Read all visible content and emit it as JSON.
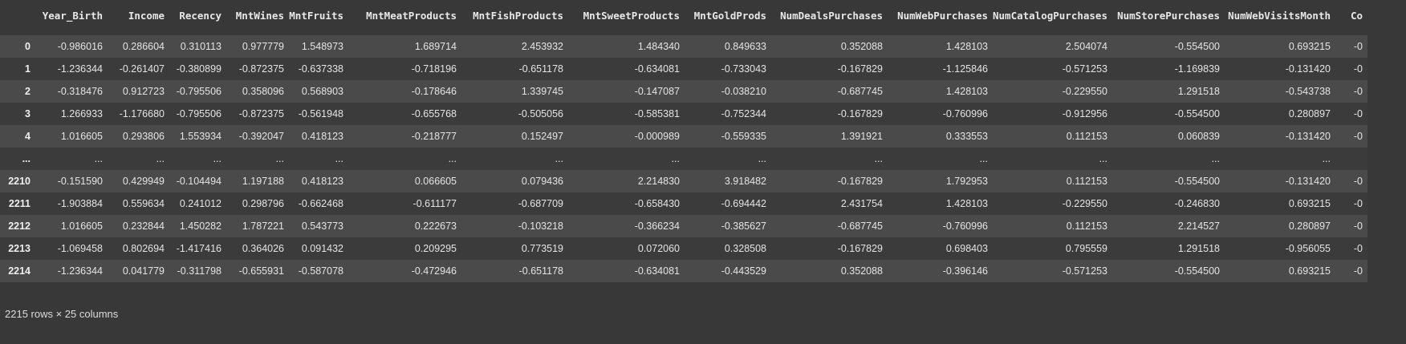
{
  "table": {
    "index_header": "",
    "columns": [
      "Year_Birth",
      "Income",
      "Recency",
      "MntWines",
      "MntFruits",
      "MntMeatProducts",
      "MntFishProducts",
      "MntSweetProducts",
      "MntGoldProds",
      "NumDealsPurchases",
      "NumWebPurchases",
      "NumCatalogPurchases",
      "NumStorePurchases",
      "NumWebVisitsMonth",
      "Co"
    ],
    "rows": [
      {
        "index": "0",
        "cells": [
          "-0.986016",
          "0.286604",
          "0.310113",
          "0.977779",
          "1.548973",
          "1.689714",
          "2.453932",
          "1.484340",
          "0.849633",
          "0.352088",
          "1.428103",
          "2.504074",
          "-0.554500",
          "0.693215",
          "-0"
        ]
      },
      {
        "index": "1",
        "cells": [
          "-1.236344",
          "-0.261407",
          "-0.380899",
          "-0.872375",
          "-0.637338",
          "-0.718196",
          "-0.651178",
          "-0.634081",
          "-0.733043",
          "-0.167829",
          "-1.125846",
          "-0.571253",
          "-1.169839",
          "-0.131420",
          "-0"
        ]
      },
      {
        "index": "2",
        "cells": [
          "-0.318476",
          "0.912723",
          "-0.795506",
          "0.358096",
          "0.568903",
          "-0.178646",
          "1.339745",
          "-0.147087",
          "-0.038210",
          "-0.687745",
          "1.428103",
          "-0.229550",
          "1.291518",
          "-0.543738",
          "-0"
        ]
      },
      {
        "index": "3",
        "cells": [
          "1.266933",
          "-1.176680",
          "-0.795506",
          "-0.872375",
          "-0.561948",
          "-0.655768",
          "-0.505056",
          "-0.585381",
          "-0.752344",
          "-0.167829",
          "-0.760996",
          "-0.912956",
          "-0.554500",
          "0.280897",
          "-0"
        ]
      },
      {
        "index": "4",
        "cells": [
          "1.016605",
          "0.293806",
          "1.553934",
          "-0.392047",
          "0.418123",
          "-0.218777",
          "0.152497",
          "-0.000989",
          "-0.559335",
          "1.391921",
          "0.333553",
          "0.112153",
          "0.060839",
          "-0.131420",
          "-0"
        ]
      },
      {
        "index": "...",
        "cells": [
          "...",
          "...",
          "...",
          "...",
          "...",
          "...",
          "...",
          "...",
          "...",
          "...",
          "...",
          "...",
          "...",
          "...",
          ""
        ]
      },
      {
        "index": "2210",
        "cells": [
          "-0.151590",
          "0.429949",
          "-0.104494",
          "1.197188",
          "0.418123",
          "0.066605",
          "0.079436",
          "2.214830",
          "3.918482",
          "-0.167829",
          "1.792953",
          "0.112153",
          "-0.554500",
          "-0.131420",
          "-0"
        ]
      },
      {
        "index": "2211",
        "cells": [
          "-1.903884",
          "0.559634",
          "0.241012",
          "0.298796",
          "-0.662468",
          "-0.611177",
          "-0.687709",
          "-0.658430",
          "-0.694442",
          "2.431754",
          "1.428103",
          "-0.229550",
          "-0.246830",
          "0.693215",
          "-0"
        ]
      },
      {
        "index": "2212",
        "cells": [
          "1.016605",
          "0.232844",
          "1.450282",
          "1.787221",
          "0.543773",
          "0.222673",
          "-0.103218",
          "-0.366234",
          "-0.385627",
          "-0.687745",
          "-0.760996",
          "0.112153",
          "2.214527",
          "0.280897",
          "-0"
        ]
      },
      {
        "index": "2213",
        "cells": [
          "-1.069458",
          "0.802694",
          "-1.417416",
          "0.364026",
          "0.091432",
          "0.209295",
          "0.773519",
          "0.072060",
          "0.328508",
          "-0.167829",
          "0.698403",
          "0.795559",
          "1.291518",
          "-0.956055",
          "-0"
        ]
      },
      {
        "index": "2214",
        "cells": [
          "-1.236344",
          "0.041779",
          "-0.311798",
          "-0.655931",
          "-0.587078",
          "-0.472946",
          "-0.651178",
          "-0.634081",
          "-0.443529",
          "0.352088",
          "-0.396146",
          "-0.571253",
          "-0.554500",
          "0.693215",
          "-0"
        ]
      }
    ]
  },
  "footer": {
    "shape_text": "2215 rows × 25 columns"
  }
}
